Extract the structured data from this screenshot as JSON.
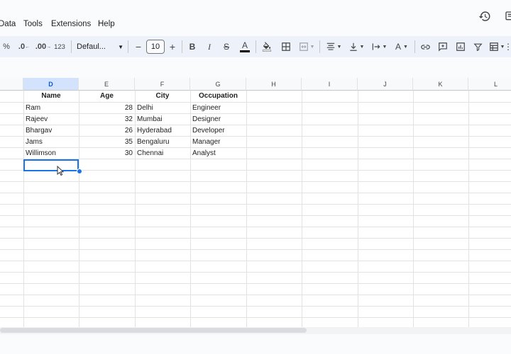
{
  "menu": [
    "Data",
    "Tools",
    "Extensions",
    "Help"
  ],
  "toolbar": {
    "percent": "%",
    "decrease_decimal": ".0",
    "increase_decimal": ".00",
    "format_123": "123",
    "font_name": "Defaul...",
    "minus": "−",
    "font_size": "10",
    "plus": "+",
    "bold": "B",
    "italic": "I",
    "strike": "S",
    "text_color": "A",
    "text_rotation": "A"
  },
  "columns": [
    "D",
    "E",
    "F",
    "G",
    "H",
    "I",
    "J",
    "K",
    "L"
  ],
  "selected_column": "D",
  "table": {
    "headers": [
      "Name",
      "Age",
      "City",
      "Occupation"
    ],
    "rows": [
      [
        "Ram",
        "28",
        "Delhi",
        "Engineer"
      ],
      [
        "Rajeev",
        "32",
        "Mumbai",
        "Designer"
      ],
      [
        "Bhargav",
        "26",
        "Hyderabad",
        "Developer"
      ],
      [
        "Jams",
        "35",
        "Bengaluru",
        "Manager"
      ],
      [
        "Willimson",
        "30",
        "Chennai",
        "Analyst"
      ]
    ]
  },
  "colors": {
    "accent": "#1a73e8",
    "toolbar_bg": "#edf2fa",
    "selected_header": "#d3e3fd"
  },
  "horizontal_scroll_fraction": 0.6
}
